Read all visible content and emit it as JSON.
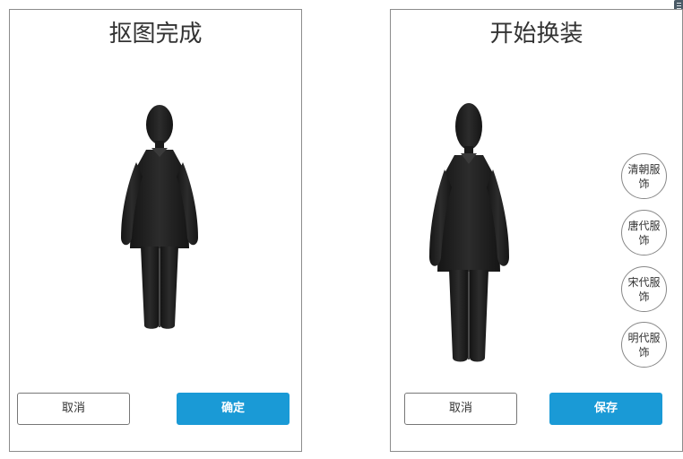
{
  "left_panel": {
    "title": "抠图完成",
    "cancel_label": "取消",
    "confirm_label": "确定"
  },
  "right_panel": {
    "title": "开始换装",
    "costumes": [
      {
        "label": "清朝服饰"
      },
      {
        "label": "唐代服饰"
      },
      {
        "label": "宋代服饰"
      },
      {
        "label": "明代服饰"
      }
    ],
    "cancel_label": "取消",
    "save_label": "保存"
  },
  "colors": {
    "primary_button": "#1a9ad6",
    "figure": "#222222",
    "border": "#8c8c8c"
  },
  "icons": {
    "corner": "menu-icon"
  }
}
